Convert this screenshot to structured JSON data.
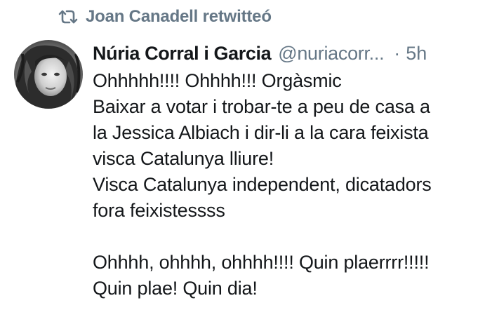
{
  "retweet": {
    "icon": "retweet-icon",
    "text": "Joan Canadell retwitteó"
  },
  "tweet": {
    "author": {
      "display_name": "Núria Corral i Garcia",
      "handle": "@nuriacorr...",
      "avatar": "avatar"
    },
    "separator": "·",
    "time": "5h",
    "lines": [
      "Ohhhhh!!!! Ohhhh!!! Orgàsmic",
      "Baixar a votar i trobar-te a peu de casa a",
      "la Jessica Albiach i dir-li a la cara feixista",
      "visca Catalunya lliure!",
      "Visca Catalunya independent, dicatadors",
      "fora feixistessss",
      "",
      "Ohhhh, ohhhh, ohhhh!!!! Quin plaerrrr!!!!!",
      "Quin plae! Quin dia!"
    ]
  },
  "colors": {
    "text": "#14171a",
    "secondary": "#657786",
    "background": "#ffffff"
  }
}
